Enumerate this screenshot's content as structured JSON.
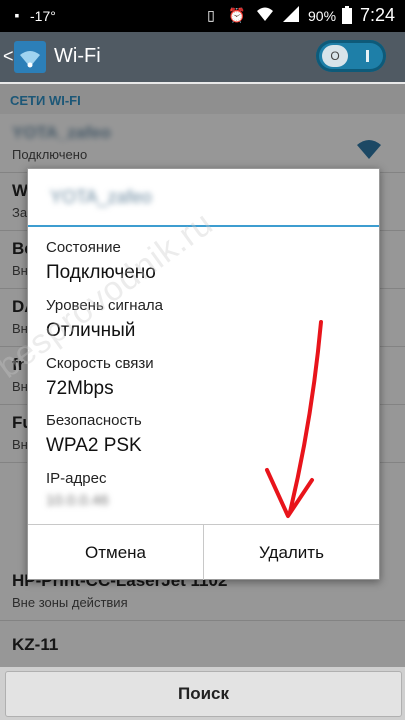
{
  "status_bar": {
    "temperature": "-17°",
    "battery": "90%",
    "time": "7:24"
  },
  "action_bar": {
    "back_glyph": "<",
    "title": "Wi-Fi",
    "toggle_glyph": "O"
  },
  "section_header": "СЕТИ WI-FI",
  "networks": [
    {
      "name": "YOTA_zafeo",
      "status": "Подключено",
      "blurred": true
    },
    {
      "name": "W",
      "status": "За"
    },
    {
      "name": "Be",
      "status": "Вне"
    },
    {
      "name": "DA",
      "status": "Вне"
    },
    {
      "name": "fr",
      "status": "Вне"
    },
    {
      "name": "Fu",
      "status": "Вне"
    },
    {
      "name": "HP-Print-CC-LaserJet 1102",
      "status": "Вне зоны действия"
    },
    {
      "name": "KZ-11",
      "status": ""
    }
  ],
  "bottom": {
    "search_label": "Поиск"
  },
  "dialog": {
    "title": "YOTA_zafeo",
    "fields": [
      {
        "label": "Состояние",
        "value": "Подключено"
      },
      {
        "label": "Уровень сигнала",
        "value": "Отличный"
      },
      {
        "label": "Скорость связи",
        "value": "72Mbps"
      },
      {
        "label": "Безопасность",
        "value": "WPA2 PSK"
      },
      {
        "label": "IP-адрес",
        "value": "10.0.0.46"
      }
    ],
    "cancel_label": "Отмена",
    "delete_label": "Удалить"
  },
  "watermark": "besprovodnik.ru",
  "colors": {
    "accent": "#3d9dd0",
    "annotation_arrow": "#e8141b"
  }
}
